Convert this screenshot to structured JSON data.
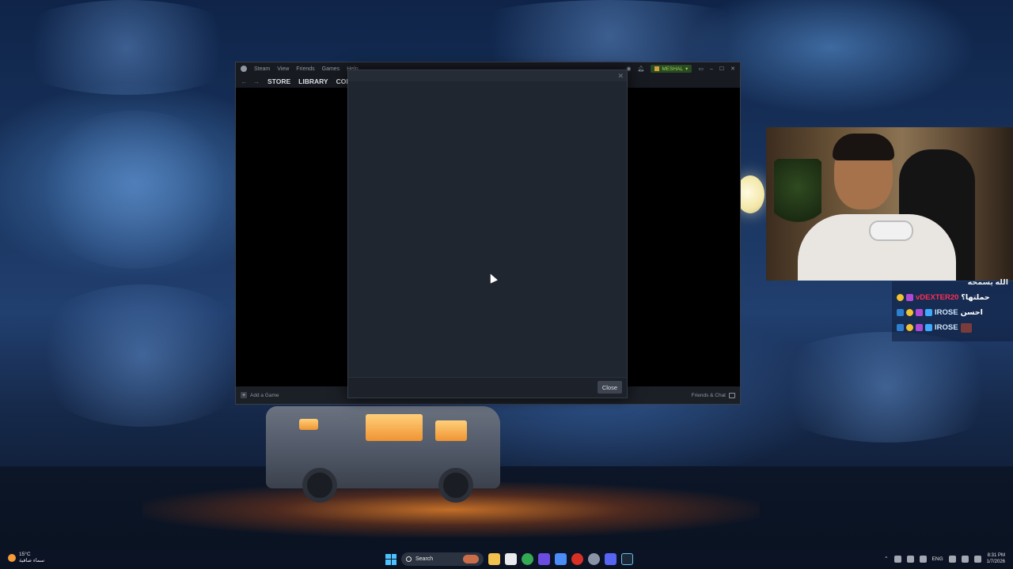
{
  "steam": {
    "menu": [
      "Steam",
      "View",
      "Friends",
      "Games",
      "Help"
    ],
    "user": "MESHAL",
    "nav": [
      "STORE",
      "LIBRARY",
      "COM"
    ],
    "add_game": "Add a Game",
    "friends_chat": "Friends & Chat"
  },
  "dialog": {
    "close_label": "Close"
  },
  "chat": {
    "lines": [
      {
        "name": "",
        "message": "الله يسمحه"
      },
      {
        "name": "vDEXTER20",
        "message": "حملتها؟"
      },
      {
        "name": "IROSE",
        "message": "احسن"
      },
      {
        "name": "IROSE",
        "message": ""
      }
    ]
  },
  "taskbar": {
    "weather_temp": "15°C",
    "weather_desc": "سماء صافية",
    "search_placeholder": "Search",
    "lang": "ENG",
    "time": "8:31 PM",
    "date": "1/7/2026"
  },
  "colors": {
    "steam_bg": "#171a21",
    "dialog_bg": "#202630",
    "user_chip": "#9ad456",
    "chat_red": "#ff2d55"
  }
}
